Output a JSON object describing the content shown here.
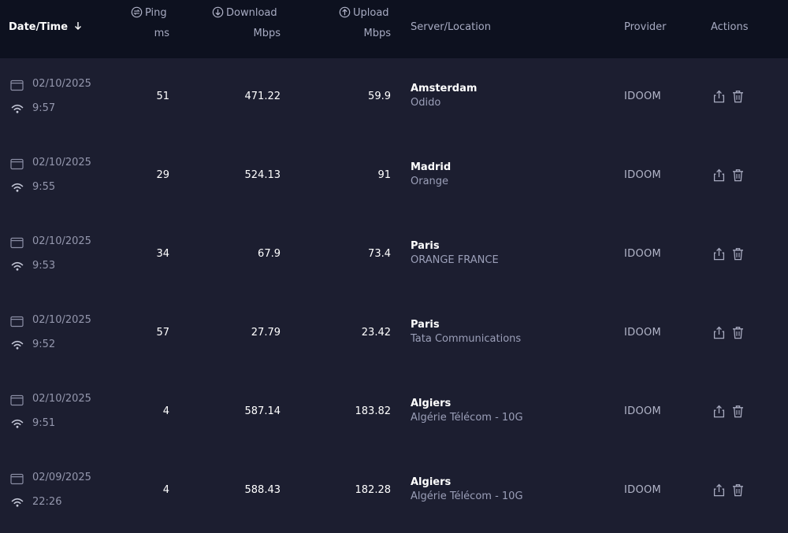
{
  "header": {
    "datetime": "Date/Time",
    "sort_icon": "arrow-down-icon",
    "ping_label": "Ping",
    "ping_unit": "ms",
    "download_label": "Download",
    "download_unit": "Mbps",
    "upload_label": "Upload",
    "upload_unit": "Mbps",
    "server": "Server/Location",
    "provider": "Provider",
    "actions": "Actions"
  },
  "rows": [
    {
      "date": "02/10/2025",
      "time": "9:57",
      "ping": "51",
      "download": "471.22",
      "upload": "59.9",
      "city": "Amsterdam",
      "isp": "Odido",
      "provider": "IDOOM"
    },
    {
      "date": "02/10/2025",
      "time": "9:55",
      "ping": "29",
      "download": "524.13",
      "upload": "91",
      "city": "Madrid",
      "isp": "Orange",
      "provider": "IDOOM"
    },
    {
      "date": "02/10/2025",
      "time": "9:53",
      "ping": "34",
      "download": "67.9",
      "upload": "73.4",
      "city": "Paris",
      "isp": "ORANGE FRANCE",
      "provider": "IDOOM"
    },
    {
      "date": "02/10/2025",
      "time": "9:52",
      "ping": "57",
      "download": "27.79",
      "upload": "23.42",
      "city": "Paris",
      "isp": "Tata Communications",
      "provider": "IDOOM"
    },
    {
      "date": "02/10/2025",
      "time": "9:51",
      "ping": "4",
      "download": "587.14",
      "upload": "183.82",
      "city": "Algiers",
      "isp": "Algérie Télécom - 10G",
      "provider": "IDOOM"
    },
    {
      "date": "02/09/2025",
      "time": "22:26",
      "ping": "4",
      "download": "588.43",
      "upload": "182.28",
      "city": "Algiers",
      "isp": "Algérie Télécom - 10G",
      "provider": "IDOOM"
    }
  ],
  "colors": {
    "background": "#1c1e30",
    "header_background": "#0d111f",
    "muted_text": "#9497ad"
  }
}
